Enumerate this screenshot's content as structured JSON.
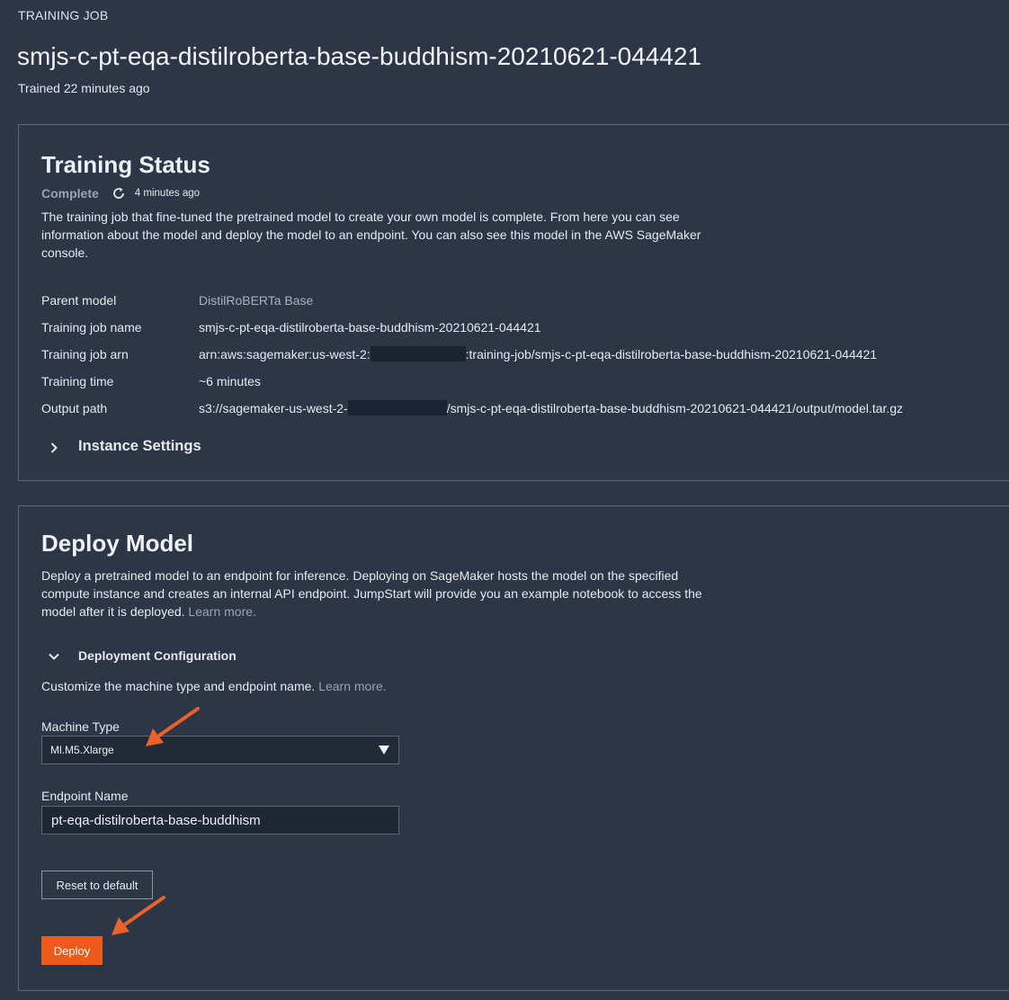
{
  "header": {
    "eyebrow": "TRAINING JOB",
    "job_title": "smjs-c-pt-eqa-distilroberta-base-buddhism-20210621-044421",
    "trained": "Trained 22 minutes ago"
  },
  "training_status": {
    "title": "Training Status",
    "status": "Complete",
    "updated": "4 minutes ago",
    "description": "The training job that fine-tuned the pretrained model to create your own model is complete. From here you can see information about the model and deploy the model to an endpoint. You can also see this model in the AWS SageMaker console.",
    "details": {
      "parent_model_key": "Parent model",
      "parent_model_val": "DistilRoBERTa Base",
      "job_name_key": "Training job name",
      "job_name_val": "smjs-c-pt-eqa-distilroberta-base-buddhism-20210621-044421",
      "job_arn_key": "Training job arn",
      "job_arn_prefix": "arn:aws:sagemaker:us-west-2:",
      "job_arn_suffix": ":training-job/smjs-c-pt-eqa-distilroberta-base-buddhism-20210621-044421",
      "time_key": "Training time",
      "time_val": "~6 minutes",
      "output_key": "Output path",
      "output_prefix": "s3://sagemaker-us-west-2-",
      "output_suffix": "/smjs-c-pt-eqa-distilroberta-base-buddhism-20210621-044421/output/model.tar.gz"
    },
    "instance_settings": "Instance Settings"
  },
  "deploy_model": {
    "title": "Deploy Model",
    "description": "Deploy a pretrained model to an endpoint for inference. Deploying on SageMaker hosts the model on the specified compute instance and creates an internal API endpoint. JumpStart will provide you an example notebook to access the model after it is deployed.",
    "learn_more": "Learn more.",
    "config_label": "Deployment Configuration",
    "customize_text": "Customize the machine type and endpoint name.",
    "customize_learn_more": "Learn more.",
    "machine_type_label": "Machine Type",
    "machine_type_value": "Ml.M5.Xlarge",
    "endpoint_name_label": "Endpoint Name",
    "endpoint_name_value": "pt-eqa-distilroberta-base-buddhism",
    "reset_label": "Reset to default",
    "deploy_label": "Deploy"
  },
  "colors": {
    "background": "#2d3646",
    "accent": "#ec5a1c",
    "arrow": "#e8622a"
  }
}
